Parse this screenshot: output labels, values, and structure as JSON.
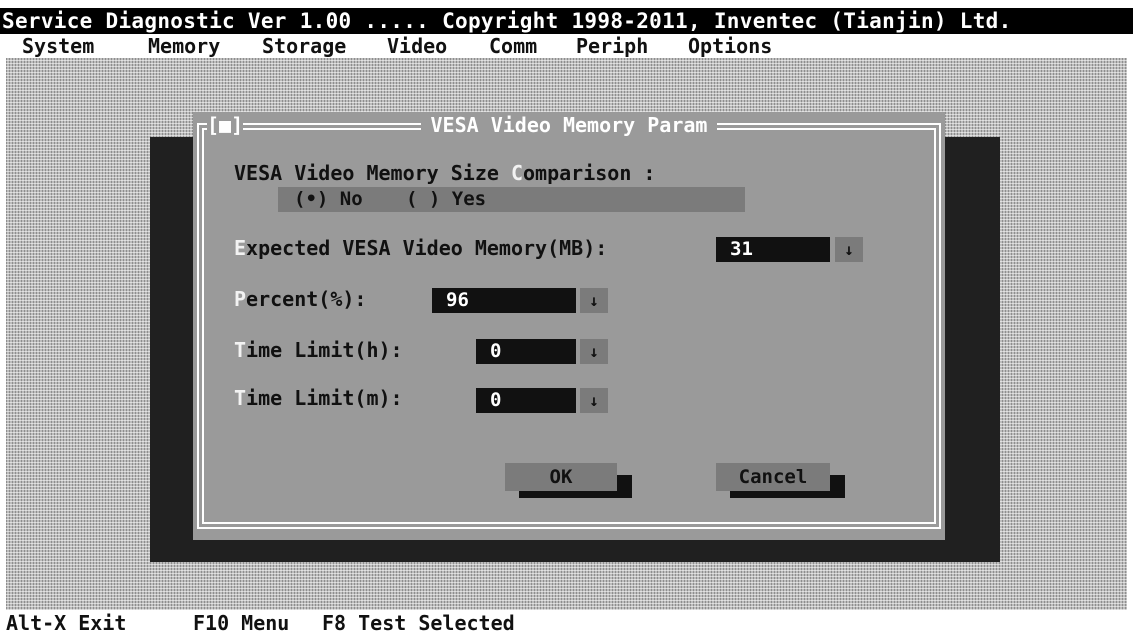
{
  "title_bar": {
    "text": "Service Diagnostic Ver 1.00 ..... Copyright 1998-2011, Inventec (Tianjin) Ltd."
  },
  "menu": [
    {
      "label": "System"
    },
    {
      "label": "Memory"
    },
    {
      "label": "Storage"
    },
    {
      "label": "Video"
    },
    {
      "label": "Comm"
    },
    {
      "label": "Periph"
    },
    {
      "label": "Options"
    }
  ],
  "dialog": {
    "close_box": "[■]",
    "title": "VESA Video Memory Param",
    "comparison": {
      "label_before": "VESA Video Memory Size ",
      "label_hot": "C",
      "label_after": "omparison :",
      "options": [
        {
          "label": "(•) No",
          "selected": true
        },
        {
          "label": "( ) Yes",
          "selected": false
        }
      ]
    },
    "expected": {
      "hot": "E",
      "label": "xpected VESA Video Memory(MB):",
      "value": "31"
    },
    "percent": {
      "hot": "P",
      "label": "ercent(%):",
      "value": "96"
    },
    "time_h": {
      "hot": "T",
      "label": "ime Limit(h):",
      "value": "0"
    },
    "time_m": {
      "hot": "T",
      "label": "ime Limit(m):",
      "value": "0"
    },
    "dropdown_glyph": "↓",
    "buttons": {
      "ok": "OK",
      "cancel": "Cancel"
    }
  },
  "status_bar": [
    {
      "label": "Alt-X Exit"
    },
    {
      "label": "F10 Menu"
    },
    {
      "label": "F8 Test Selected"
    }
  ]
}
